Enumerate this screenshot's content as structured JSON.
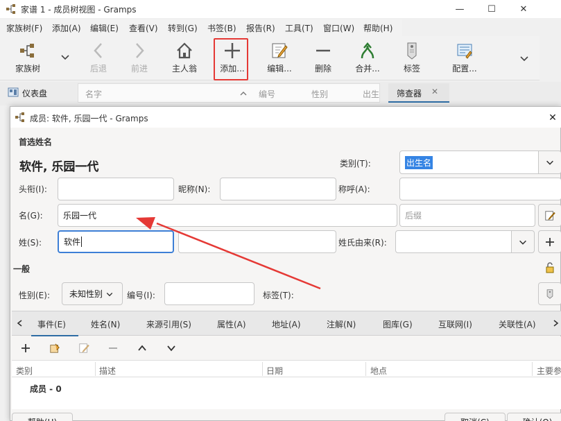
{
  "main_window": {
    "title": "家谱 1 - 成员树视图 - Gramps",
    "controls": {
      "minimize": "—",
      "maximize": "☐",
      "close": "✕"
    },
    "menu": [
      "家族树(F)",
      "添加(A)",
      "编辑(E)",
      "查看(V)",
      "转到(G)",
      "书签(B)",
      "报告(R)",
      "工具(T)",
      "窗口(W)",
      "帮助(H)"
    ],
    "toolbar": {
      "family_tree": "家族树",
      "back": "后退",
      "forward": "前进",
      "home": "主人翁",
      "add": "添加...",
      "edit": "编辑...",
      "delete": "删除",
      "merge": "合并...",
      "tags": "标签",
      "config": "配置..."
    },
    "sidebar_dashboard": "仪表盘",
    "list_columns": [
      "名字",
      "编号",
      "性别",
      "出生"
    ],
    "filter_tab": "筛查器"
  },
  "dialog": {
    "title": "成员: 软件, 乐园一代 - Gramps",
    "preferred_name_section": "首选姓名",
    "display_name": "软件, 乐园一代",
    "labels": {
      "type": "类别(T):",
      "title": "头衔(I):",
      "nickname": "昵称(N):",
      "call": "称呼(A):",
      "given": "名(G):",
      "surname": "姓(S):",
      "origin": "姓氏由来(R):",
      "gender": "性别(E):",
      "id": "编号(I):",
      "tags": "标签(T):"
    },
    "values": {
      "type": "出生名",
      "given": "乐园一代",
      "surname": "软件",
      "gender": "未知性别"
    },
    "placeholders": {
      "suffix": "后缀"
    },
    "general_section": "一般",
    "tabs": [
      "事件(E)",
      "姓名(N)",
      "来源引用(S)",
      "属性(A)",
      "地址(A)",
      "注解(N)",
      "图库(G)",
      "互联网(I)",
      "关联性(A)"
    ],
    "events_columns": [
      "类别",
      "描述",
      "日期",
      "地点",
      "主要参"
    ],
    "events_group": "成员 - 0",
    "buttons": {
      "help": "帮助(H)",
      "cancel": "取消(C)",
      "ok": "确认(O)"
    }
  },
  "colors": {
    "accent": "#3584e4",
    "tab_underline": "#2e6da4",
    "annotation_red": "#e53935"
  }
}
